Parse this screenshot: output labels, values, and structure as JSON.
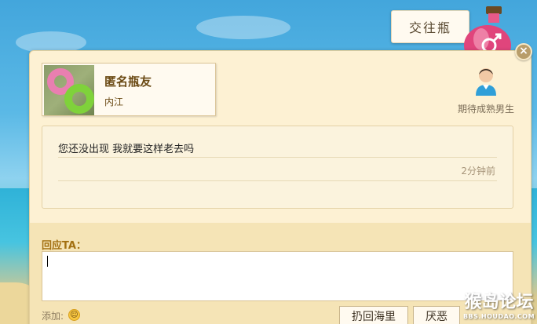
{
  "top": {
    "swap_button_label": "交往瓶"
  },
  "profile": {
    "nickname": "匿名瓶友",
    "city": "内江",
    "wish_text": "期待成熟男生"
  },
  "message": {
    "text": "您还没出现 我就要这样老去吗",
    "time": "2分钟前"
  },
  "reply": {
    "label": "回应TA：",
    "value": "",
    "add_label": "添加:",
    "throw_back_label": "扔回海里",
    "disgust_label": "厌恶"
  },
  "watermark": {
    "title": "猴岛论坛",
    "url": "BBS.HOUDAO.COM"
  },
  "colors": {
    "panel_bg": "#fdf1d3",
    "accent": "#a37011"
  },
  "icons": {
    "close": "close-icon",
    "user": "user-icon",
    "emoji": "smile-icon",
    "bottle": "bottle-icon"
  }
}
